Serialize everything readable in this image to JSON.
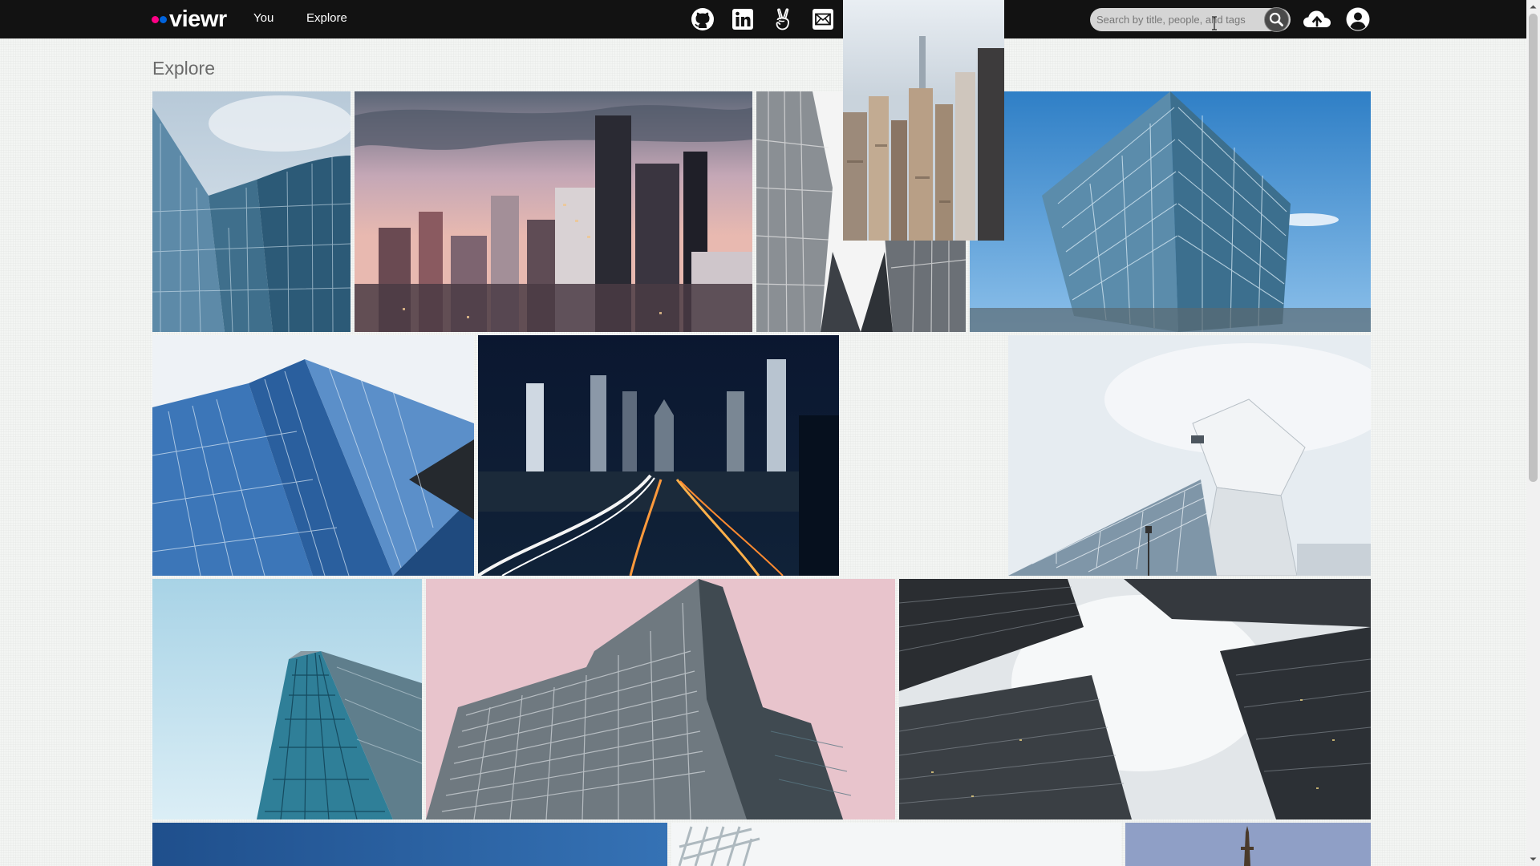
{
  "app": {
    "brand": "viewr"
  },
  "nav": {
    "you": "You",
    "explore": "Explore"
  },
  "social": [
    {
      "name": "github",
      "icon": "github-icon"
    },
    {
      "name": "linkedin",
      "icon": "linkedin-icon"
    },
    {
      "name": "angellist",
      "icon": "angellist-icon"
    },
    {
      "name": "email",
      "icon": "mail-icon"
    }
  ],
  "search": {
    "placeholder": "Search by title, people, and tags",
    "value": ""
  },
  "header_icons": {
    "search": "search-icon",
    "upload": "cloud-upload-icon",
    "account": "user-circle-icon"
  },
  "page": {
    "title": "Explore"
  },
  "photos": [
    {
      "subject": "glass-curved-towers"
    },
    {
      "subject": "city-skyline-sunset"
    },
    {
      "subject": "mirrored-glass-facades"
    },
    {
      "subject": "glass-cube-building"
    },
    {
      "subject": "blue-glass-pyramid-facade"
    },
    {
      "subject": "night-skyline-highway-light-trails"
    },
    {
      "subject": "manhattan-aerial"
    },
    {
      "subject": "white-angular-museum"
    },
    {
      "subject": "teal-glass-tower"
    },
    {
      "subject": "pink-sky-apartment-block"
    },
    {
      "subject": "foggy-skyscrapers-looking-up"
    },
    {
      "subject": "blue-sky-building"
    },
    {
      "subject": "white-lattice-structure"
    },
    {
      "subject": "eiffel-tower-top"
    }
  ],
  "colors": {
    "topbar": "#121212",
    "brand_pink": "#ff0084",
    "brand_blue": "#0063dc",
    "page_bg": "#f3f5f3"
  }
}
